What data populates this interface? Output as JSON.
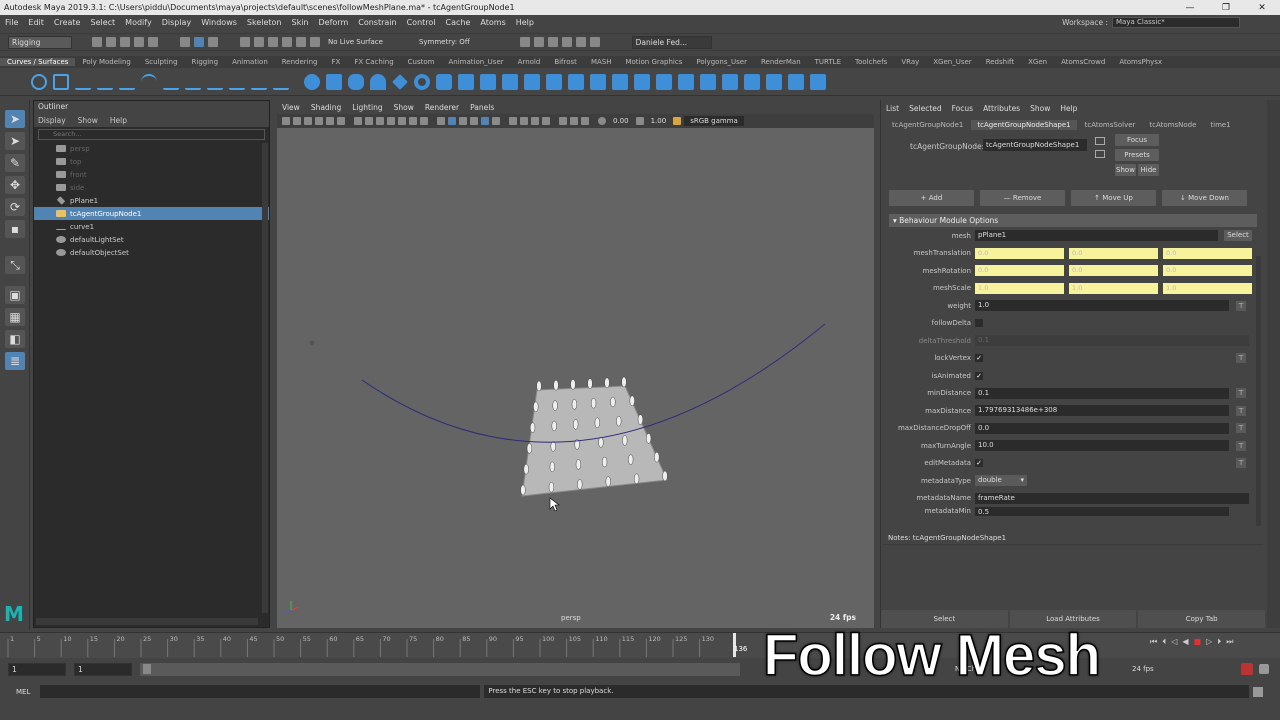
{
  "window": {
    "title": "Autodesk Maya 2019.3.1: C:\\Users\\piddu\\Documents\\maya\\projects\\default\\scenes\\followMeshPlane.ma*  -  tcAgentGroupNode1"
  },
  "menubar": {
    "items": [
      "File",
      "Edit",
      "Create",
      "Select",
      "Modify",
      "Display",
      "Windows",
      "Skeleton",
      "Skin",
      "Deform",
      "Constrain",
      "Control",
      "Cache",
      "Atoms",
      "Help"
    ]
  },
  "workspace": {
    "label": "Workspace :",
    "value": "Maya Classic*"
  },
  "statusline": {
    "mode": "Rigging",
    "live_surface": "No Live Surface",
    "symmetry": "Symmetry: Off",
    "user": "Daniele Fed..."
  },
  "shelf": {
    "tabs": [
      "Curves / Surfaces",
      "Poly Modeling",
      "Sculpting",
      "Rigging",
      "Animation",
      "Rendering",
      "FX",
      "FX Caching",
      "Custom",
      "Animation_User",
      "Arnold",
      "Bifrost",
      "MASH",
      "Motion Graphics",
      "Polygons_User",
      "RenderMan",
      "TURTLE",
      "Toolchefs",
      "VRay",
      "XGen_User",
      "Redshift",
      "XGen",
      "AtomsCrowd",
      "AtomsPhysx"
    ]
  },
  "outliner": {
    "tab": "Outliner",
    "menu": [
      "Display",
      "Show",
      "Help"
    ],
    "search_placeholder": "Search...",
    "items": [
      "persp",
      "top",
      "front",
      "side",
      "pPlane1",
      "tcAgentGroupNode1",
      "curve1",
      "defaultLightSet",
      "defaultObjectSet"
    ]
  },
  "viewport": {
    "menu": [
      "View",
      "Shading",
      "Lighting",
      "Show",
      "Renderer",
      "Panels"
    ],
    "exposure": "0.00",
    "gamma_value": "1.00",
    "color_space": "sRGB gamma",
    "camera": "persp",
    "fps": "24 fps"
  },
  "attribute_editor": {
    "menu": [
      "List",
      "Selected",
      "Focus",
      "Attributes",
      "Show",
      "Help"
    ],
    "tabs": [
      "tcAgentGroupNode1",
      "tcAgentGroupNodeShape1",
      "tcAtomsSolver",
      "tcAtomsNode",
      "time1"
    ],
    "node_label": "tcAgentGroupNode:",
    "node_value": "tcAgentGroupNodeShape1",
    "focus": "Focus",
    "presets": "Presets",
    "show": "Show",
    "hide": "Hide",
    "buttons": [
      "+ Add",
      "— Remove",
      "↑ Move Up",
      "↓ Move Down"
    ],
    "section": "Behaviour Module Options",
    "attrs": {
      "mesh": {
        "label": "mesh",
        "value": "pPlane1",
        "select": "Select"
      },
      "meshTranslation": {
        "label": "meshTranslation",
        "values": [
          "0.0",
          "0.0",
          "0.0"
        ]
      },
      "meshRotation": {
        "label": "meshRotation",
        "values": [
          "0.0",
          "0.0",
          "0.0"
        ]
      },
      "meshScale": {
        "label": "meshScale",
        "values": [
          "1.0",
          "1.0",
          "1.0"
        ]
      },
      "weight": {
        "label": "weight",
        "value": "1.0"
      },
      "followDelta": {
        "label": "followDelta",
        "checked": false
      },
      "deltaThreshold": {
        "label": "deltaThreshold",
        "value": "0.1"
      },
      "lockVertex": {
        "label": "lockVertex",
        "checked": true
      },
      "isAnimated": {
        "label": "isAnimated",
        "checked": true
      },
      "minDistance": {
        "label": "minDistance",
        "value": "0.1"
      },
      "maxDistance": {
        "label": "maxDistance",
        "value": "1.79769313486e+308"
      },
      "maxDistanceDropOff": {
        "label": "maxDistanceDropOff",
        "value": "0.0"
      },
      "maxTurnAngle": {
        "label": "maxTurnAngle",
        "value": "10.0"
      },
      "editMetadata": {
        "label": "editMetadata",
        "checked": true
      },
      "metadataType": {
        "label": "metadataType",
        "value": "double"
      },
      "metadataName": {
        "label": "metadataName",
        "value": "frameRate"
      },
      "metadataMin": {
        "label": "metadataMin",
        "value": "0.5"
      }
    },
    "notes": "Notes:  tcAgentGroupNodeShape1",
    "footer": [
      "Select",
      "Load Attributes",
      "Copy Tab"
    ]
  },
  "timeline": {
    "ticks": [
      "1",
      "5",
      "10",
      "15",
      "20",
      "25",
      "30",
      "35",
      "40",
      "45",
      "50",
      "55",
      "60",
      "65",
      "70",
      "75",
      "80",
      "85",
      "90",
      "95",
      "100",
      "105",
      "110",
      "115",
      "120",
      "125",
      "130"
    ],
    "current_frame": "136",
    "fps": "24 fps"
  },
  "range": {
    "start": "1",
    "anim_start": "1",
    "anim_end_left": "No Ch"
  },
  "cmdline": {
    "label": "MEL",
    "message": "Press the ESC key to stop playback."
  },
  "overlay": {
    "text": "Follow Mesh"
  },
  "colors": {
    "selection": "#5284b3",
    "highlight": "#f7f29c",
    "stop": "#e03030"
  }
}
